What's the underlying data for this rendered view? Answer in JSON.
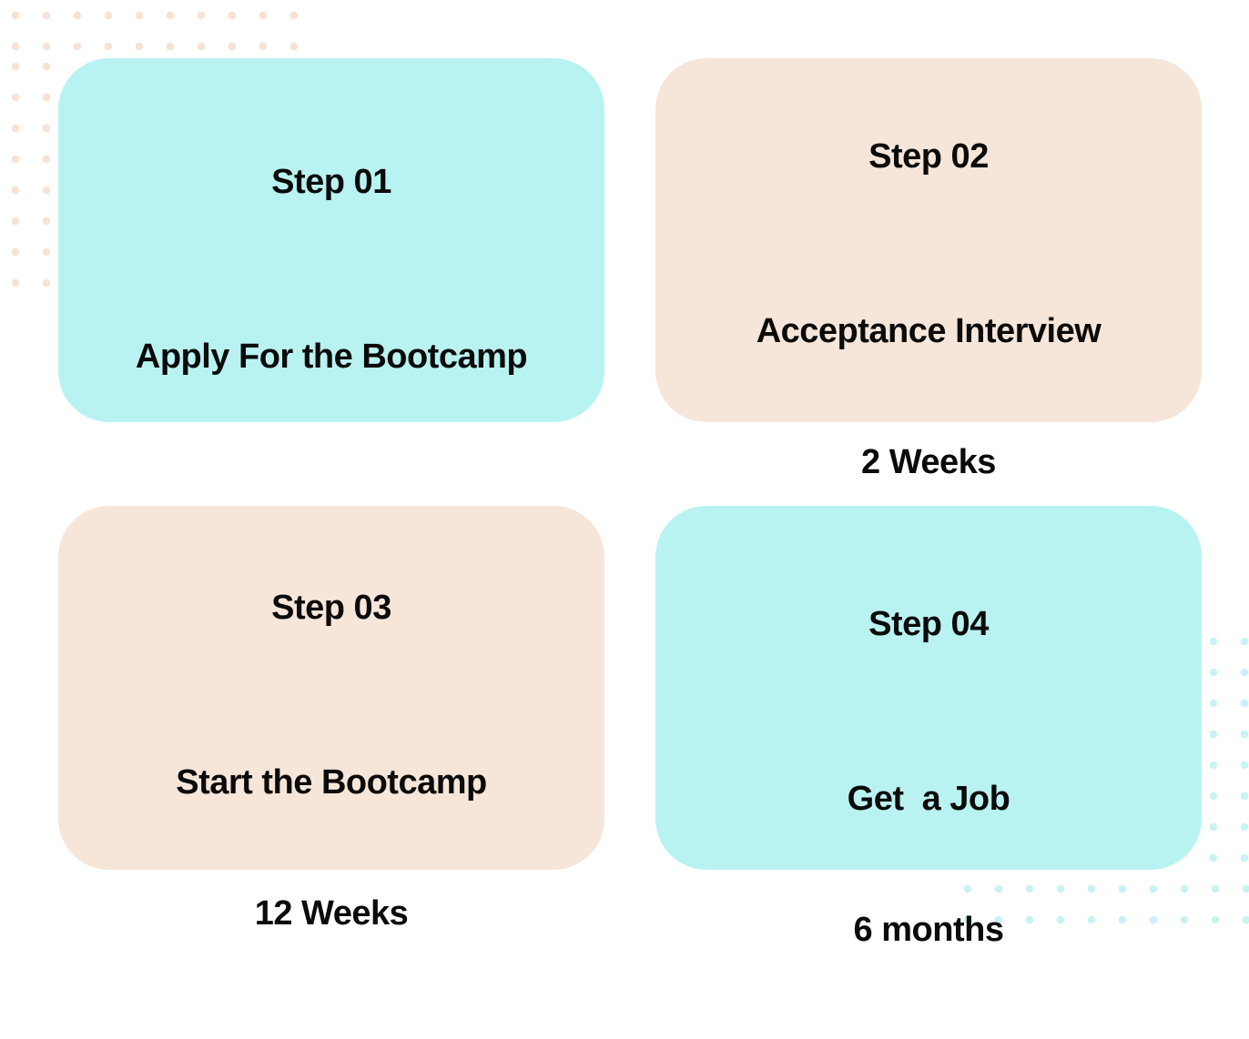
{
  "colors": {
    "card_aqua": "#b9f3f1",
    "card_peach": "#f6e6da",
    "text": "#0b0b0b",
    "dots_peach": "#f6e3d3",
    "dots_aqua": "#c9f3f2"
  },
  "steps": [
    {
      "label": "Step 01",
      "title": "Apply For the Bootcamp",
      "duration": ""
    },
    {
      "label": "Step 02",
      "title": "Acceptance Interview",
      "duration": "2 Weeks"
    },
    {
      "label": "Step 03",
      "title": "Start the Bootcamp",
      "duration": "12 Weeks"
    },
    {
      "label": "Step 04",
      "title": "Get  a Job",
      "duration": "6 months"
    }
  ]
}
